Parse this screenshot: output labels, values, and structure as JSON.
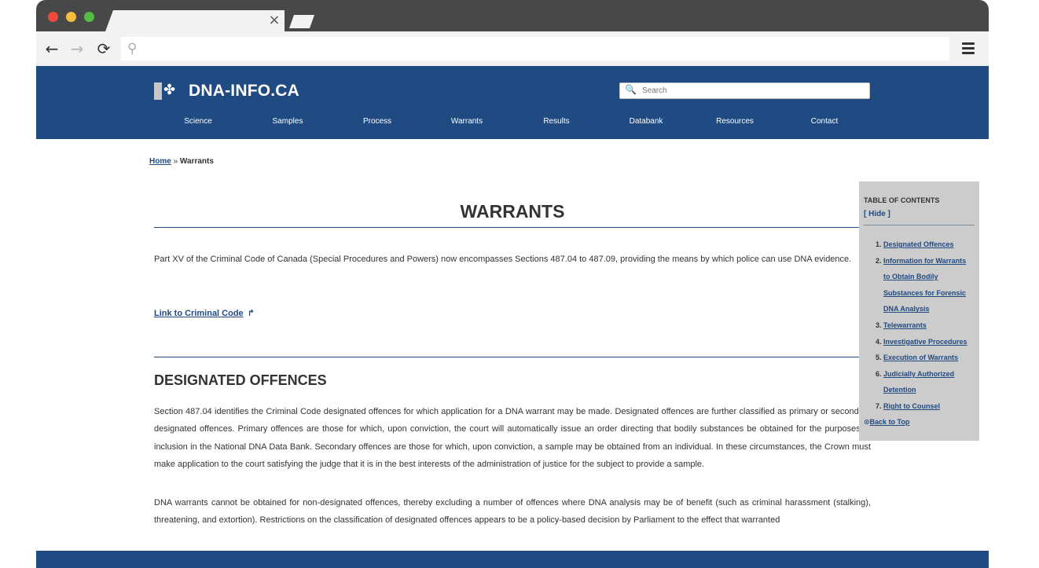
{
  "browser": {
    "tab_close": "×",
    "back_icon": "←",
    "forward_icon": "→",
    "reload_icon": "⟳",
    "search_icon": "⚲"
  },
  "site": {
    "title": "DNA-INFO.CA",
    "logo_leaf": "✤",
    "search_placeholder": "Search",
    "search_icon": "🔍",
    "nav": [
      "Science",
      "Samples",
      "Process",
      "Warrants",
      "Results",
      "Databank",
      "Resources",
      "Contact"
    ],
    "brand_color": "#1f4a82"
  },
  "breadcrumb": {
    "home": "Home",
    "separator": " » ",
    "current": "Warrants"
  },
  "page": {
    "title": "WARRANTS",
    "intro": "Part XV of the Criminal Code of Canada (Special Procedures and Powers) now encompasses Sections 487.04 to 487.09, providing the means by which police can use DNA evidence.",
    "code_link": "Link to Criminal Code",
    "code_link_icon": "↱",
    "section_title": "DESIGNATED OFFENCES",
    "para1": "Section 487.04 identifies the Criminal Code designated offences for which application for a DNA warrant may be made. Designated offences are further classified as primary or secondary designated offences. Primary offences are those for which, upon conviction, the court will automatically issue an order directing that bodily substances be obtained for the purposes of inclusion in the National DNA Data Bank. Secondary offences are those for which, upon conviction, a sample may be obtained from an individual.  In these circumstances, the Crown must make application to the court satisfying the judge that it is in the best interests of the administration of justice for the subject to provide a sample.",
    "para2": "DNA warrants cannot be obtained for non-designated offences, thereby excluding a number of offences where DNA analysis may be of benefit (such as criminal harassment (stalking), threatening, and extortion). Restrictions on the classification of designated offences appears to be a policy-based decision by Parliament to the effect that warranted"
  },
  "toc": {
    "heading": "TABLE OF CONTENTS",
    "hide": "[ Hide ]",
    "items": [
      {
        "num": "1.",
        "label": "Designated Offences"
      },
      {
        "num": "2.",
        "label": "Information for Warrants to Obtain Bodily Substances for Forensic DNA Analysis"
      },
      {
        "num": "3.",
        "label": "Telewarrants"
      },
      {
        "num": "4.",
        "label": "Investigative Procedures"
      },
      {
        "num": "5.",
        "label": "Execution of Warrants"
      },
      {
        "num": "6.",
        "label": "Judicially Authorized Detention"
      },
      {
        "num": "7.",
        "label": "Right to Counsel"
      }
    ],
    "back_icon": "⊙",
    "back_to_top": "Back to Top"
  }
}
